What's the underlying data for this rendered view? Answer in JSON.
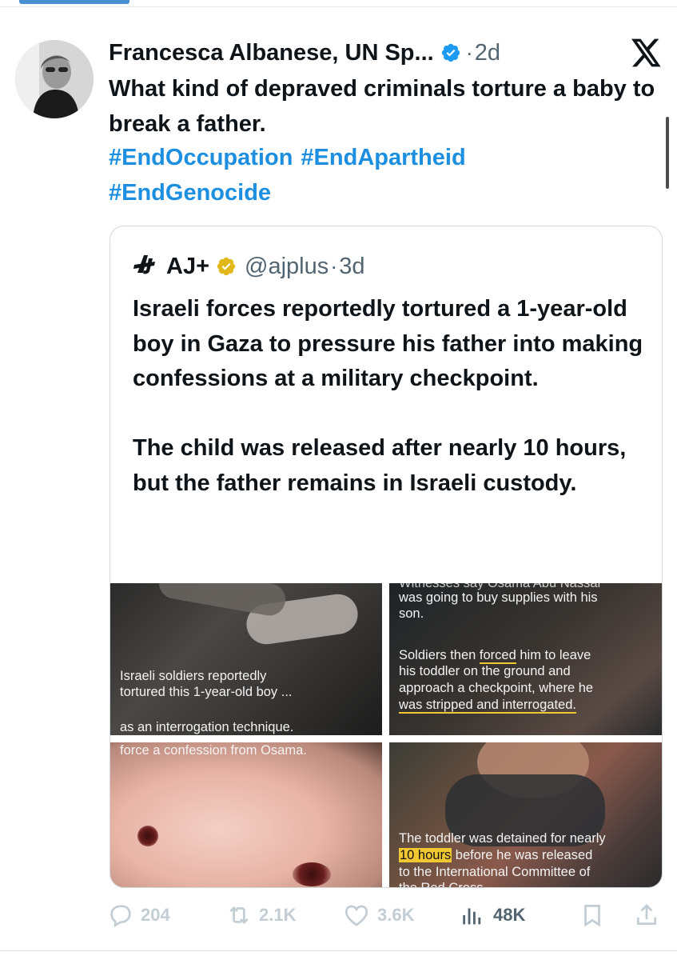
{
  "post": {
    "author_name": "Francesca Albanese, UN Sp...",
    "time": "2d",
    "text": "What kind of depraved criminals torture a baby to break a father.",
    "hashtags": [
      "#EndOccupation",
      "#EndApartheid",
      "#EndGenocide"
    ]
  },
  "quote": {
    "logo": "AJ+",
    "name": "AJ+",
    "handle": "@ajplus",
    "time": "3d",
    "paragraph1": "Israeli forces reportedly tortured a 1-year-old boy in Gaza to pressure his father into making confessions at a military checkpoint.",
    "paragraph2": "The child was released after nearly 10 hours, but the father remains in Israeli custody.",
    "media": {
      "cell1": {
        "caption1_line1": "Israeli soldiers reportedly",
        "caption1_line2": "tortured this 1-year-old boy ...",
        "caption2": "as an interrogation technique."
      },
      "cell2": {
        "top_cut": "Witnesses say Osama Abu Nassar",
        "line1": "was going to buy supplies with his",
        "line2": "son.",
        "line3_pre": "Soldiers then ",
        "line3_ul": "forced",
        "line3_post": " him to leave",
        "line4": "his toddler on the ground and",
        "line5": "approach a checkpoint, where he",
        "line6": "was stripped and interrogated."
      },
      "cell3": {
        "caption": "force a confession from Osama."
      },
      "cell4": {
        "line1": "The toddler was detained for nearly",
        "line2_hl": "10 hours",
        "line2_post": " before he was released",
        "line3": "to the International Committee of",
        "line4_cut": "the Red Cross."
      }
    }
  },
  "actions": {
    "replies": "204",
    "reposts": "2.1K",
    "likes": "3.6K",
    "views": "48K"
  },
  "colors": {
    "link": "#1d8fe0",
    "verified": "#1d9bf0",
    "gold_verified": "#e2b719",
    "caption_highlight": "#f2c832"
  },
  "icons": [
    "verified-badge-icon",
    "x-logo-icon",
    "gold-verified-badge-icon",
    "reply-icon",
    "repost-icon",
    "like-icon",
    "views-icon",
    "bookmark-icon",
    "share-icon"
  ]
}
